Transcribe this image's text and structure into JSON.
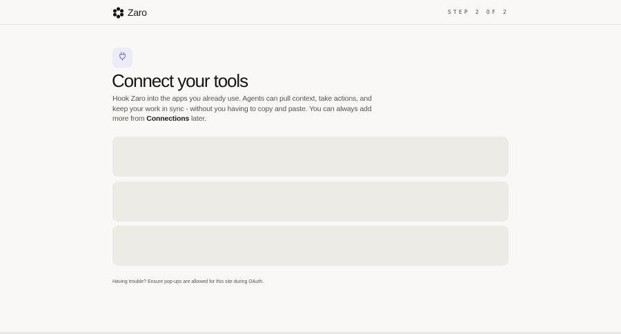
{
  "brand": {
    "logo_icon": "flower-logo-icon",
    "name": "Zaro"
  },
  "progress": {
    "label": "STEP 2 OF 2"
  },
  "main": {
    "icon": "plug-icon",
    "title": "Connect your tools",
    "intro_text": "Hook Zaro into the apps you already use. Agents can pull context, take actions, and keep your work in sync - without you having to copy and paste. You can always add more from",
    "intro_link": "Connections",
    "intro_tail": " later.",
    "connection_cards": [
      {
        "state": "loading"
      },
      {
        "state": "loading"
      },
      {
        "state": "loading"
      }
    ],
    "help_text": "Having trouble? Ensure pop-ups are allowed for this site during OAuth."
  },
  "colors": {
    "background": "#f9f8f6",
    "card": "#ecebe6",
    "icon_tile": "#ecebf8",
    "accent": "#6a66c9",
    "text": "#1b1a18",
    "muted_text": "#56534e"
  }
}
